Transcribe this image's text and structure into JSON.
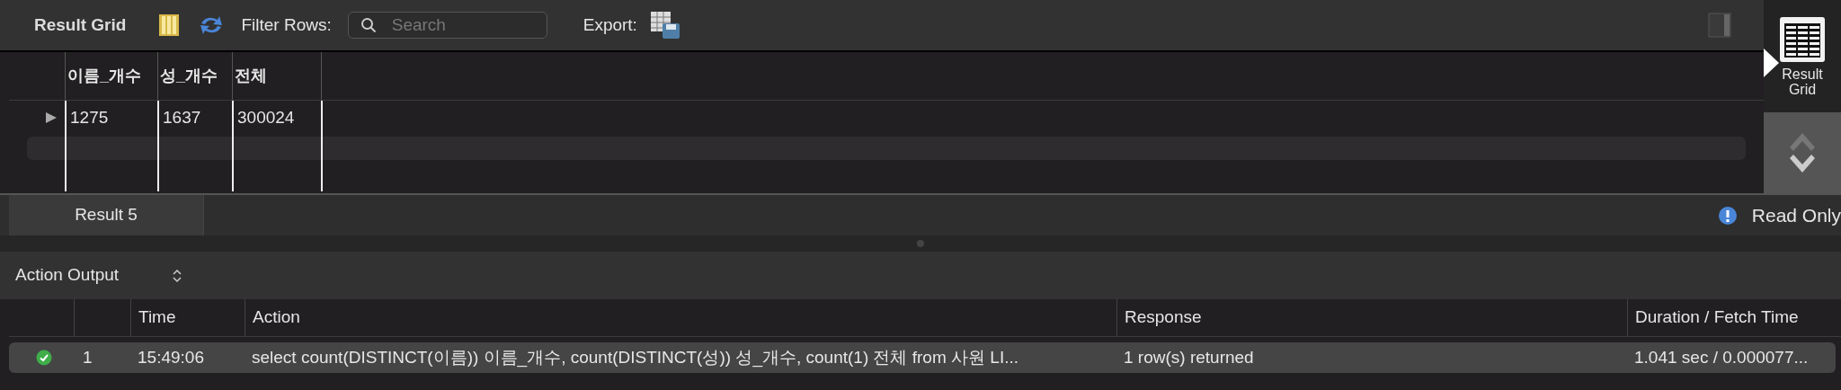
{
  "toolbar": {
    "title": "Result Grid",
    "filter_label": "Filter Rows:",
    "search": {
      "placeholder": "Search"
    },
    "export_label": "Export:"
  },
  "grid": {
    "columns": [
      "이름_개수",
      "성_개수",
      "전체"
    ],
    "rows": [
      {
        "current": true,
        "cells": [
          "1275",
          "1637",
          "300024"
        ]
      }
    ]
  },
  "side_panel": [
    {
      "label": "Result Grid",
      "selected": true
    }
  ],
  "result_tabs": [
    {
      "label": "Result 5",
      "selected": true
    }
  ],
  "status": {
    "text": "Read Only"
  },
  "action_output": {
    "title": "Action Output",
    "columns": [
      "Time",
      "Action",
      "Response",
      "Duration / Fetch Time"
    ],
    "rows": [
      {
        "kind": "success",
        "index": "1",
        "time": "15:49:06",
        "action": "select  count(DISTINCT(이름)) 이름_개수, count(DISTINCT(성)) 성_개수, count(1) 전체 from 사원 LI...",
        "response": "1 row(s) returned",
        "duration": "1.041 sec / 0.000077..."
      }
    ]
  }
}
